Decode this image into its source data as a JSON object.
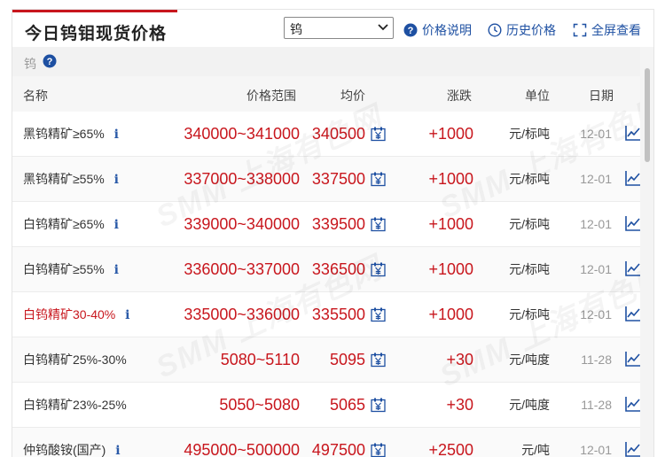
{
  "header": {
    "title": "今日钨钼现货价格",
    "select_value": "钨",
    "tools": [
      {
        "label": "价格说明",
        "icon": "question-circle-icon"
      },
      {
        "label": "历史价格",
        "icon": "clock-icon"
      },
      {
        "label": "全屏查看",
        "icon": "fullscreen-icon"
      }
    ]
  },
  "subbar": {
    "label": "钨",
    "icon": "question-circle-icon"
  },
  "columns": {
    "name": "名称",
    "range": "价格范围",
    "avg": "均价",
    "change": "涨跌",
    "unit": "单位",
    "date": "日期"
  },
  "rows": [
    {
      "name": "黑钨精矿≥65%",
      "info": "i",
      "range": "340000~341000",
      "avg": "340500",
      "change": "+1000",
      "unit": "元/标吨",
      "date": "12-01"
    },
    {
      "name": "黑钨精矿≥55%",
      "info": "i",
      "range": "337000~338000",
      "avg": "337500",
      "change": "+1000",
      "unit": "元/标吨",
      "date": "12-01"
    },
    {
      "name": "白钨精矿≥65%",
      "info": "i",
      "range": "339000~340000",
      "avg": "339500",
      "change": "+1000",
      "unit": "元/标吨",
      "date": "12-01"
    },
    {
      "name": "白钨精矿≥55%",
      "info": "i",
      "range": "336000~337000",
      "avg": "336500",
      "change": "+1000",
      "unit": "元/标吨",
      "date": "12-01"
    },
    {
      "name": "白钨精矿30-40%",
      "info": "i",
      "range": "335000~336000",
      "avg": "335500",
      "change": "+1000",
      "unit": "元/标吨",
      "date": "12-01",
      "highlight": true
    },
    {
      "name": "白钨精矿25%-30%",
      "info": "",
      "range": "5080~5110",
      "avg": "5095",
      "change": "+30",
      "unit": "元/吨度",
      "date": "11-28"
    },
    {
      "name": "白钨精矿23%-25%",
      "info": "",
      "range": "5050~5080",
      "avg": "5065",
      "change": "+30",
      "unit": "元/吨度",
      "date": "11-28"
    },
    {
      "name": "仲钨酸铵(国产)",
      "info": "i",
      "range": "495000~500000",
      "avg": "497500",
      "change": "+2500",
      "unit": "元/吨",
      "date": "12-01"
    }
  ],
  "watermark": [
    "SMM 上海有色网",
    "SMM 上海有色网",
    "SMM 上海有色网",
    "SMM 上海有色网"
  ],
  "colors": {
    "accent": "#c8161d",
    "link": "#1e50a2",
    "up": "#c8161d"
  }
}
